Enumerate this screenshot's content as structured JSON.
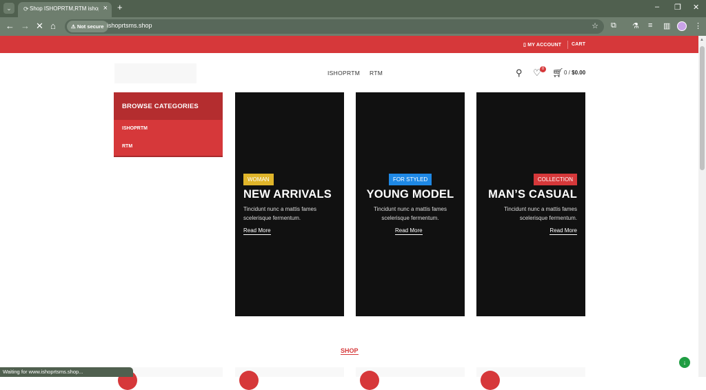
{
  "browser": {
    "tab_title": "Shop ISHOPRTM,RTM ishoprtsms",
    "url": "ishoprtsms.shop",
    "security_label": "Not secure",
    "status_text": "Waiting for www.ishoprtsms.shop..."
  },
  "topbar": {
    "account": "MY ACCOUNT",
    "cart": "CART"
  },
  "header": {
    "nav": [
      "ISHOPRTM",
      "RTM"
    ],
    "wishlist_count": "0",
    "cart_count": "0 /",
    "cart_amount": "$0.00"
  },
  "categories": {
    "title": "BROWSE CATEGORIES",
    "items": [
      "ISHOPRTM",
      "RTM"
    ]
  },
  "banners": [
    {
      "badge": "WOMAN",
      "badge_color": "#e0b52a",
      "title": "NEW ARRIVALS",
      "line1": "Tincidunt nunc a mattis fames",
      "line2": "scelerisque fermentum.",
      "link": "Read More"
    },
    {
      "badge": "FOR STYLED",
      "badge_color": "#1e88e5",
      "title": "YOUNG MODEL",
      "line1": "Tincidunt nunc a mattis fames",
      "line2": "scelerisque fermentum.",
      "link": "Read More"
    },
    {
      "badge": "COLLECTION",
      "badge_color": "#d6383a",
      "title": "MAN’S CASUAL",
      "line1": "Tincidunt nunc a mattis fames",
      "line2": "scelerisque fermentum.",
      "link": "Read More"
    }
  ],
  "shop_heading": "SHOP",
  "colors": {
    "accent": "#d6383a",
    "dark": "#111111",
    "chrome": "#6e7e6e"
  }
}
